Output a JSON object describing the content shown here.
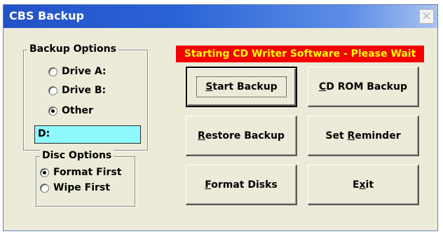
{
  "window": {
    "title": "CBS Backup",
    "close_glyph": "×"
  },
  "backup_options": {
    "legend": "Backup Options",
    "options": [
      {
        "label": "Drive A:",
        "checked": false
      },
      {
        "label": "Drive B:",
        "checked": false
      },
      {
        "label": "Other",
        "checked": true
      }
    ],
    "path_value": "D:"
  },
  "disc_options": {
    "legend": "Disc Options",
    "options": [
      {
        "label": "Format First",
        "checked": true
      },
      {
        "label": "Wipe First",
        "checked": false
      }
    ]
  },
  "status": {
    "text": "Starting CD Writer Software - Please Wait"
  },
  "buttons": {
    "start_backup": {
      "pre": "",
      "key": "S",
      "post": "tart Backup"
    },
    "cd_rom_backup": {
      "pre": "",
      "key": "C",
      "post": "D ROM Backup"
    },
    "restore_backup": {
      "pre": "",
      "key": "R",
      "post": "estore Backup"
    },
    "set_reminder": {
      "pre": "Set ",
      "key": "R",
      "post": "eminder"
    },
    "format_disks": {
      "pre": "",
      "key": "F",
      "post": "ormat Disks"
    },
    "exit": {
      "pre": "E",
      "key": "x",
      "post": "it"
    }
  },
  "colors": {
    "title_bar": "#2452c8",
    "status_bg": "#f50000",
    "status_text": "#ffff00",
    "path_field_bg": "#8ef9ff",
    "dialog_bg": "#ecebd9"
  }
}
